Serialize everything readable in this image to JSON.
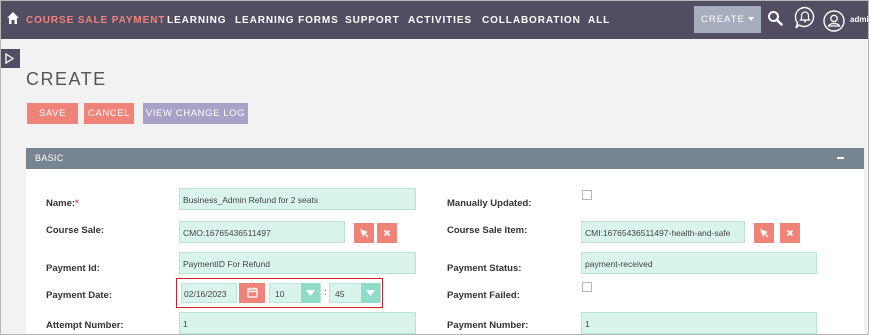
{
  "nav": {
    "items": [
      "COURSE SALE PAYMENT",
      "LEARNING",
      "LEARNING FORMS",
      "SUPPORT",
      "ACTIVITIES",
      "COLLABORATION",
      "ALL"
    ],
    "create_label": "CREATE",
    "user_label": "admi",
    "active_color": "#f08377",
    "bar_color": "#534d64"
  },
  "page": {
    "title": "CREATE",
    "buttons": {
      "save": "SAVE",
      "cancel": "CANCEL",
      "view_log": "VIEW CHANGE LOG"
    }
  },
  "panel": {
    "title": "BASIC",
    "fields": {
      "name": {
        "label": "Name:",
        "required": "*",
        "value": "Business_Admin Refund for 2 seats"
      },
      "manually_updated": {
        "label": "Manually Updated:",
        "checked": false
      },
      "course_sale": {
        "label": "Course Sale:",
        "value": "CMO:16765436511497"
      },
      "course_sale_item": {
        "label": "Course Sale Item:",
        "value": "CMI:16765436511497-health-and-safe"
      },
      "payment_id": {
        "label": "Payment Id:",
        "value": "PaymentID For Refund"
      },
      "payment_status": {
        "label": "Payment Status:",
        "value": "payment-received"
      },
      "payment_date": {
        "label": "Payment Date:",
        "date": "02/16/2023",
        "hour": "10",
        "separator": ":",
        "minute": "45"
      },
      "payment_failed": {
        "label": "Payment Failed:",
        "checked": false
      },
      "attempt_number": {
        "label": "Attempt Number:",
        "value": "1"
      },
      "payment_number": {
        "label": "Payment Number:",
        "value": "1"
      }
    }
  }
}
